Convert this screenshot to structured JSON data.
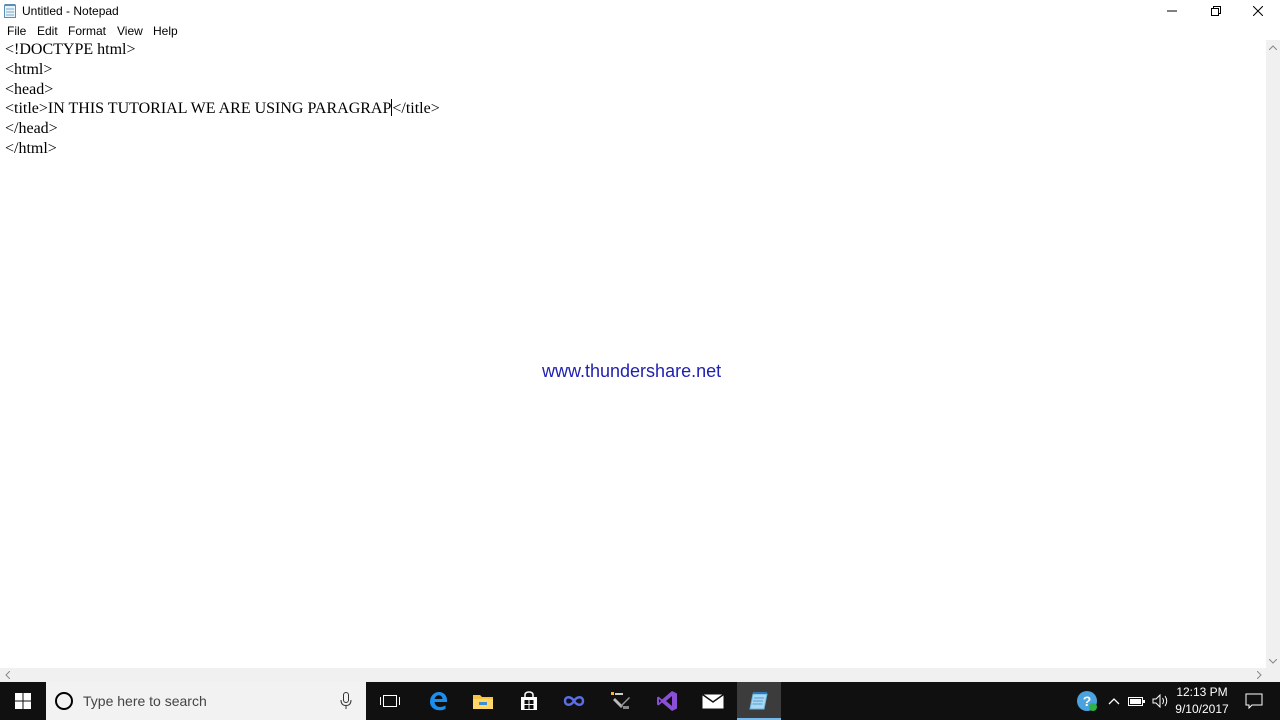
{
  "window": {
    "title": "Untitled - Notepad"
  },
  "menu": {
    "items": [
      "File",
      "Edit",
      "Format",
      "View",
      "Help"
    ]
  },
  "editor": {
    "lines": [
      "<!DOCTYPE html>",
      "<html>",
      "<head>",
      "<title>IN THIS TUTORIAL WE ARE USING PARAGRAP",
      "</head>",
      "</html>"
    ],
    "line4_after_caret": "</title>"
  },
  "watermark": "www.thundershare.net",
  "taskbar": {
    "search_placeholder": "Type here to search",
    "apps": [
      "task-view",
      "edge",
      "file-explorer",
      "store",
      "app-loop",
      "app-tools",
      "visual-studio",
      "mail",
      "notepad"
    ],
    "active_app": "notepad",
    "clock": {
      "time": "12:13 PM",
      "date": "9/10/2017"
    }
  },
  "colors": {
    "watermark": "#1f1fb0",
    "taskbar": "#101010",
    "accent": "#0078d7"
  }
}
